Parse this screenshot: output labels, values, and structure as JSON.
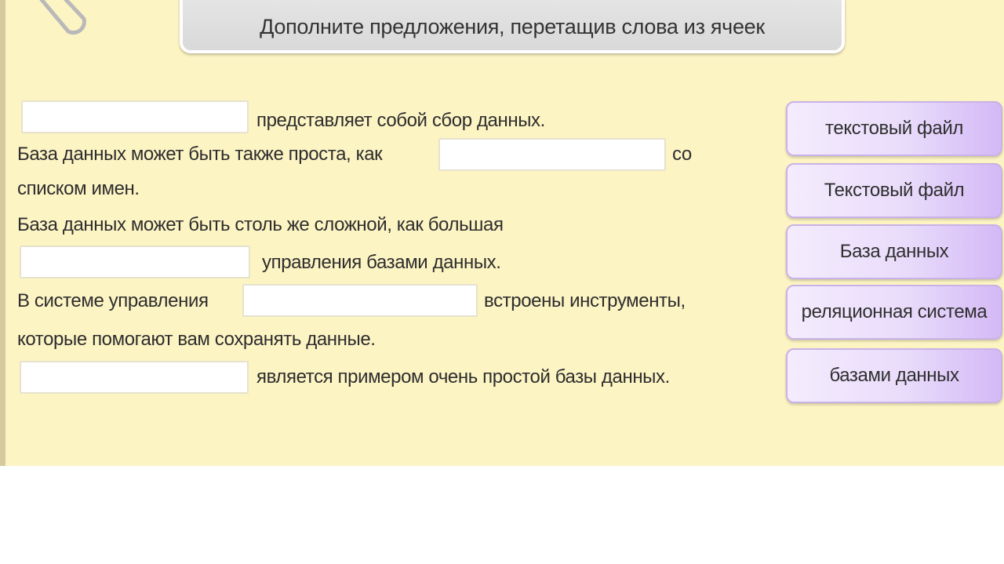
{
  "header": {
    "title": "Дополните предложения, перетащив слова из ячеек"
  },
  "sentences": {
    "s1_after": "представляет собой сбор данных.",
    "s2_before": "База данных может быть также проста, как",
    "s2_after": "со",
    "s2_line2": "списком имен.",
    "s3_line1": "База данных может быть столь же сложной, как большая",
    "s3_after": "управления базами данных.",
    "s4_before": "В системе управления",
    "s4_after": "встроены инструменты,",
    "s4_line2": "которые помогают вам сохранять данные.",
    "s5_after": "является примером очень простой базы данных."
  },
  "word_bank": [
    {
      "label": "текстовый файл"
    },
    {
      "label": "Текстовый файл"
    },
    {
      "label": "База данных"
    },
    {
      "label": "реляционная система"
    },
    {
      "label": "базами данных"
    }
  ]
}
